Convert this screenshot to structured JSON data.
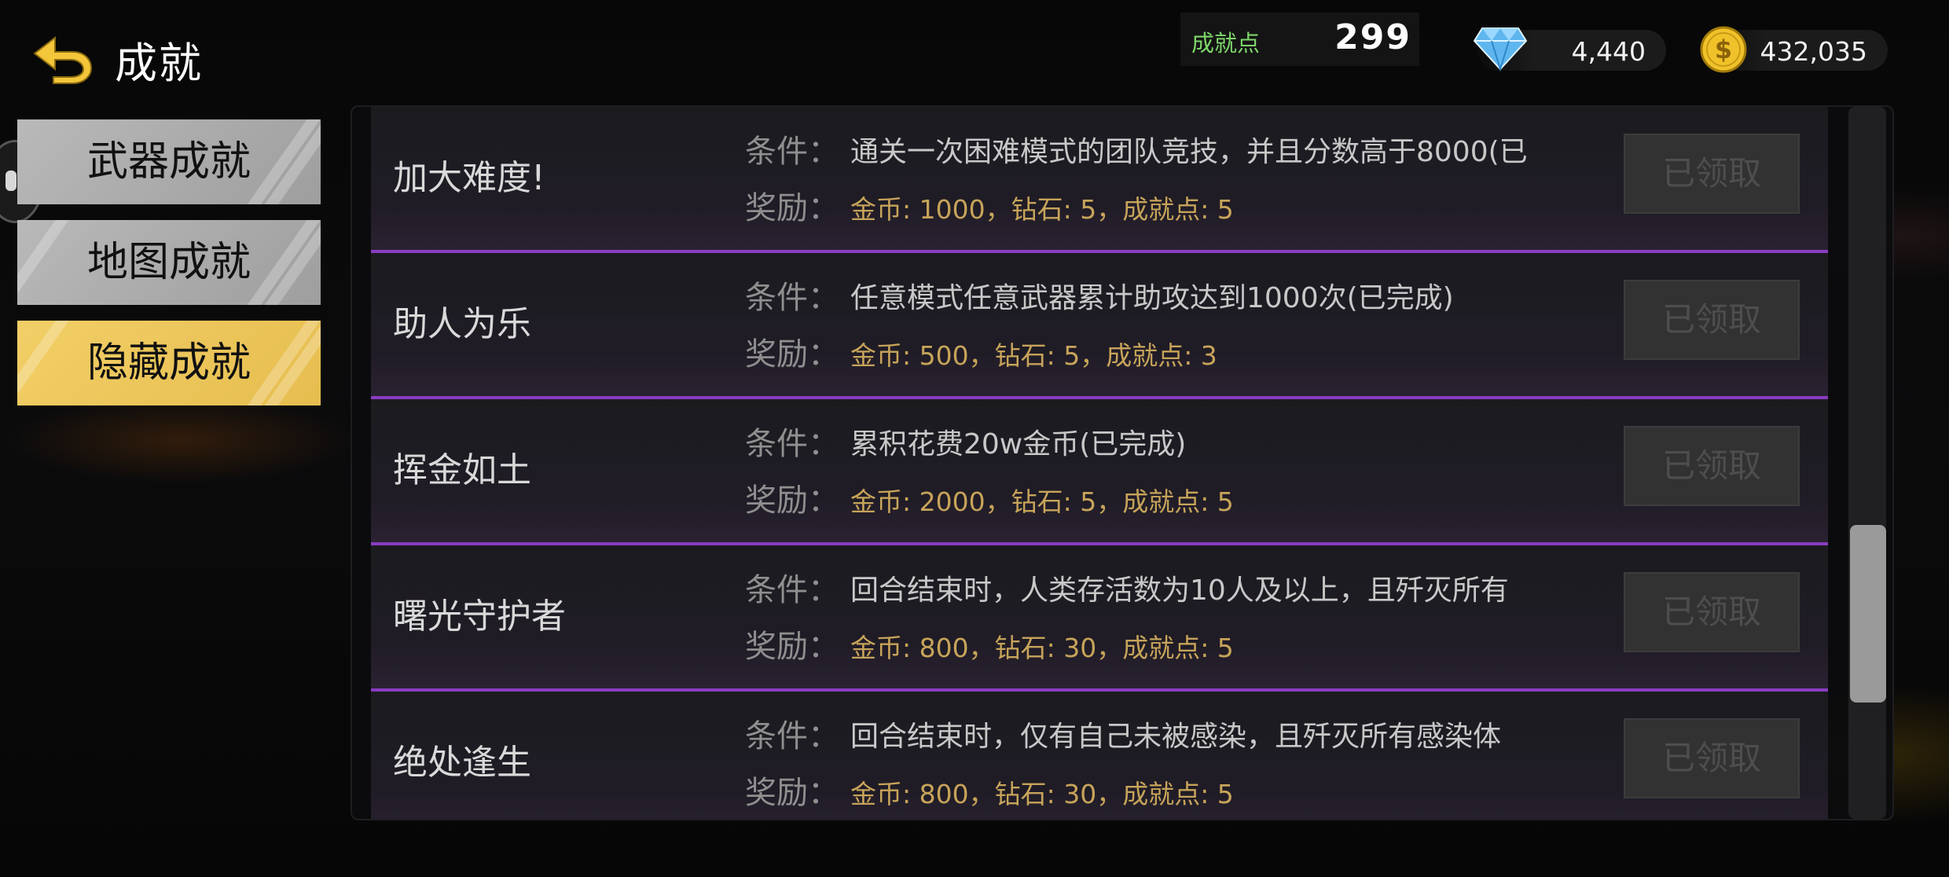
{
  "header": {
    "title": "成就",
    "points_label": "成就点",
    "points_value": "299",
    "diamonds": "4,440",
    "coins": "432,035"
  },
  "tabs": [
    {
      "label": "武器成就",
      "active": false
    },
    {
      "label": "地图成就",
      "active": false
    },
    {
      "label": "隐藏成就",
      "active": true
    }
  ],
  "list": {
    "condition_key": "条件：",
    "reward_key": "奖励：",
    "items": [
      {
        "name": "加大难度!",
        "condition": "通关一次困难模式的团队竞技，并且分数高于8000(已",
        "reward": "金币: 1000，钻石: 5，成就点: 5",
        "button": "已领取"
      },
      {
        "name": "助人为乐",
        "condition": "任意模式任意武器累计助攻达到1000次(已完成)",
        "reward": "金币: 500，钻石: 5，成就点: 3",
        "button": "已领取"
      },
      {
        "name": "挥金如土",
        "condition": "累积花费20w金币(已完成)",
        "reward": "金币: 2000，钻石: 5，成就点: 5",
        "button": "已领取"
      },
      {
        "name": "曙光守护者",
        "condition": "回合结束时，人类存活数为10人及以上，且歼灭所有",
        "reward": "金币: 800，钻石: 30，成就点: 5",
        "button": "已领取"
      },
      {
        "name": "绝处逢生",
        "condition": "回合结束时，仅有自己未被感染，且歼灭所有感染体",
        "reward": "金币: 800，钻石: 30，成就点: 5",
        "button": "已领取"
      }
    ]
  },
  "colors": {
    "accent_yellow": "#f2cf67",
    "purple_divider": "#8a3cc2",
    "points_green": "#7dd66a",
    "reward_gold": "#c7a45a"
  },
  "icons": {
    "back": "back-arrow-icon",
    "diamond": "diamond-icon",
    "coin": "dollar-coin-icon"
  }
}
